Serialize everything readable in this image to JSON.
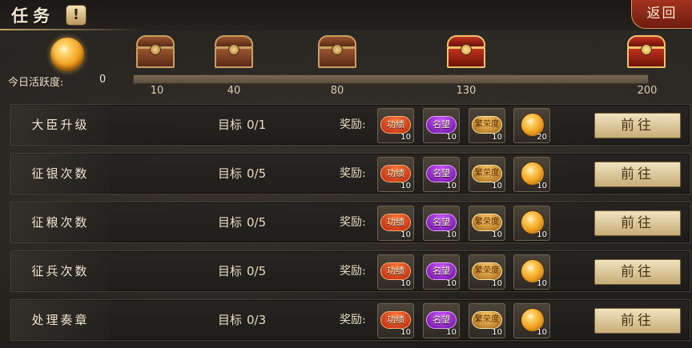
{
  "header": {
    "title": "任务",
    "info_symbol": "!",
    "back_label": "返回"
  },
  "activity": {
    "label": "今日活跃度:",
    "value": "0",
    "progress": 0,
    "milestones": [
      {
        "value": "10",
        "chest": "brown"
      },
      {
        "value": "40",
        "chest": "brown"
      },
      {
        "value": "80",
        "chest": "brown"
      },
      {
        "value": "130",
        "chest": "red"
      },
      {
        "value": "200",
        "chest": "red"
      }
    ]
  },
  "reward_icons": {
    "merit": "功绩",
    "fame": "名望",
    "prosperity": "繁荣度"
  },
  "tasks": [
    {
      "name": "大臣升级",
      "goal_label": "目标",
      "goal": "0/1",
      "reward_label": "奖励:",
      "counts": [
        "10",
        "10",
        "10",
        "20"
      ],
      "button": "前往"
    },
    {
      "name": "征银次数",
      "goal_label": "目标",
      "goal": "0/5",
      "reward_label": "奖励:",
      "counts": [
        "10",
        "10",
        "10",
        "10"
      ],
      "button": "前往"
    },
    {
      "name": "征粮次数",
      "goal_label": "目标",
      "goal": "0/5",
      "reward_label": "奖励:",
      "counts": [
        "10",
        "10",
        "10",
        "10"
      ],
      "button": "前往"
    },
    {
      "name": "征兵次数",
      "goal_label": "目标",
      "goal": "0/5",
      "reward_label": "奖励:",
      "counts": [
        "10",
        "10",
        "10",
        "10"
      ],
      "button": "前往"
    },
    {
      "name": "处理奏章",
      "goal_label": "目标",
      "goal": "0/3",
      "reward_label": "奖励:",
      "counts": [
        "10",
        "10",
        "10",
        "10"
      ],
      "button": "前往"
    }
  ]
}
